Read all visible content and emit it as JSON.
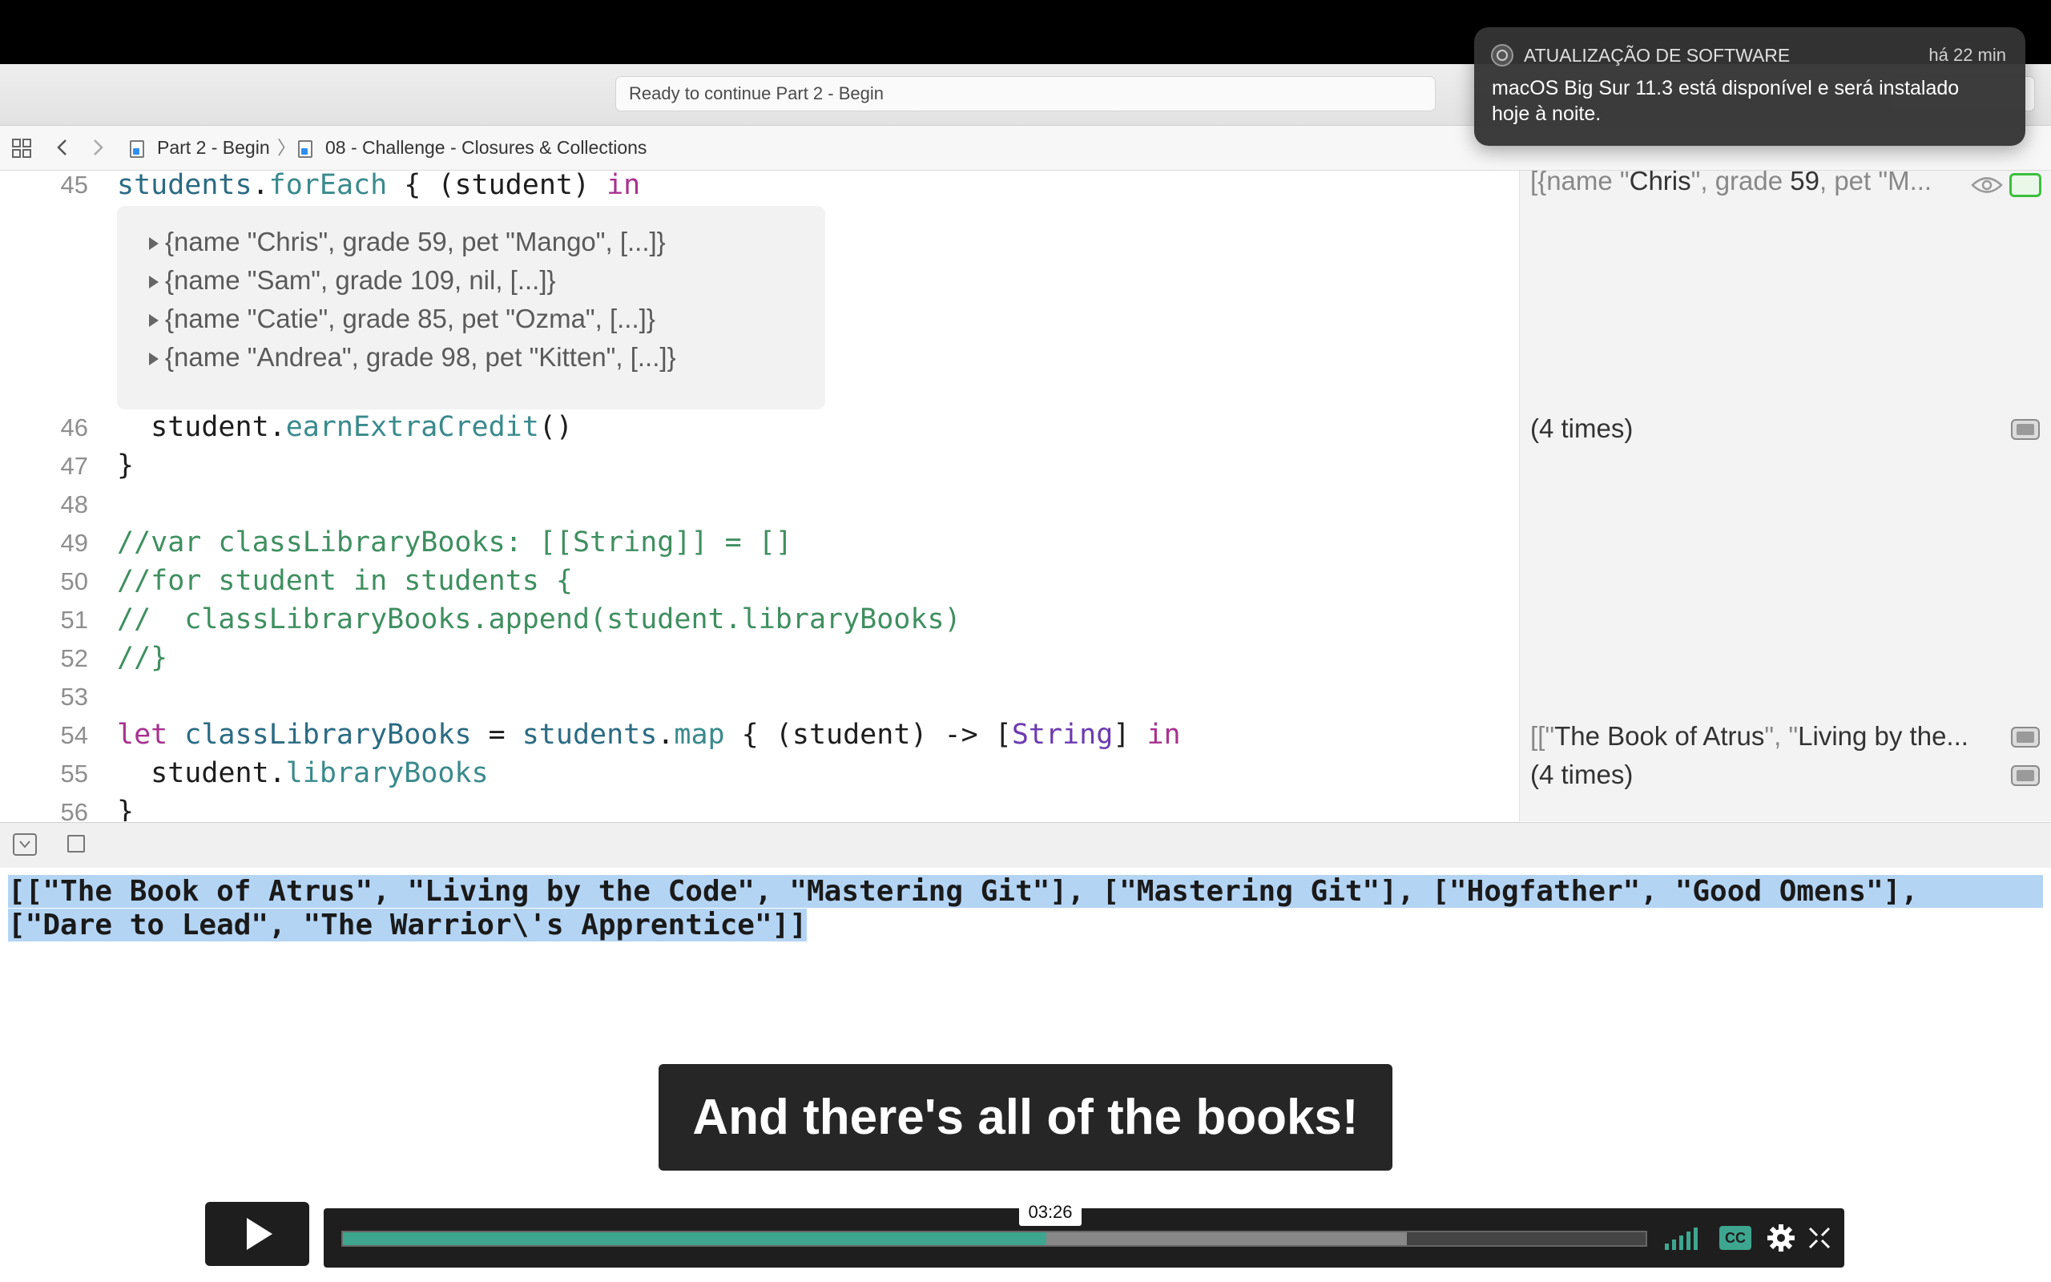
{
  "titlebar": {
    "status": "Ready to continue Part 2 - Begin"
  },
  "jumpbar": {
    "crumbs": [
      "Part 2 - Begin",
      "08 - Challenge - Closures & Collections"
    ]
  },
  "notification": {
    "app": "ATUALIZAÇÃO DE SOFTWARE",
    "time": "há 22 min",
    "line1": "macOS Big Sur 11.3 está disponível e será instalado",
    "line2": "hoje à noite."
  },
  "editor": {
    "line_numbers": [
      "45",
      "46",
      "47",
      "48",
      "49",
      "50",
      "51",
      "52",
      "53",
      "54",
      "55",
      "56"
    ],
    "l45": {
      "a": "students",
      "b": ".",
      "c": "forEach",
      "d": " { (student) ",
      "e": "in"
    },
    "popover": [
      "{name \"Chris\", grade 59, pet \"Mango\", [...]}",
      "{name \"Sam\", grade 109, nil, [...]}",
      "{name \"Catie\", grade 85, pet \"Ozma\", [...]}",
      "{name \"Andrea\", grade 98, pet \"Kitten\", [...]}"
    ],
    "l46": {
      "a": "  student.",
      "b": "earnExtraCredit",
      "c": "()"
    },
    "l47": "}",
    "l49": "//var classLibraryBooks: [[String]] = []",
    "l50": "//for student in students {",
    "l51": "//  classLibraryBooks.append(student.libraryBooks)",
    "l52": "//}",
    "l54": {
      "kw": "let",
      "name": " classLibraryBooks",
      "eq": " = ",
      "obj": "students",
      "dot": ".",
      "fn": "map",
      "mid": " { (student) -> [",
      "type": "String",
      "end": "] ",
      "in": "in"
    },
    "l55": {
      "a": "  student.",
      "b": "libraryBooks"
    },
    "l56": "}"
  },
  "results": {
    "r45": {
      "p1": "[{name \"",
      "p2": "Chris",
      "p3": "\", grade ",
      "p4": "59",
      "p5": ", pet \"M..."
    },
    "r46": "(4 times)",
    "r54": {
      "p1": "[[\"",
      "p2": "The Book of Atrus",
      "p3": "\", \"",
      "p4": "Living by the..."
    },
    "r55": "(4 times)"
  },
  "console": {
    "line1": "[[\"The Book of Atrus\", \"Living by the Code\", \"Mastering Git\"], [\"Mastering Git\"], [\"Hogfather\", \"Good Omens\"],",
    "line2": "[\"Dare to Lead\", \"The Warrior\\'s Apprentice\"]]"
  },
  "subtitle": "And there's all of the books!",
  "player": {
    "timecode": "03:26",
    "played_fraction": 0.54,
    "buffered_fraction": 0.817,
    "cc_label": "CC"
  },
  "colors": {
    "accent_played": "#3ea68e",
    "selection": "#b4d4f4",
    "keyword": "#a8328f",
    "comment": "#3f8f60"
  },
  "icons": [
    "grid-icon",
    "back-chevron-icon",
    "forward-chevron-icon",
    "swift-file-icon",
    "eye-icon",
    "quicklook-icon",
    "console-toggle-icon",
    "play-icon",
    "volume-icon",
    "cc-icon",
    "gear-icon",
    "fullscreen-icon",
    "software-update-icon"
  ]
}
